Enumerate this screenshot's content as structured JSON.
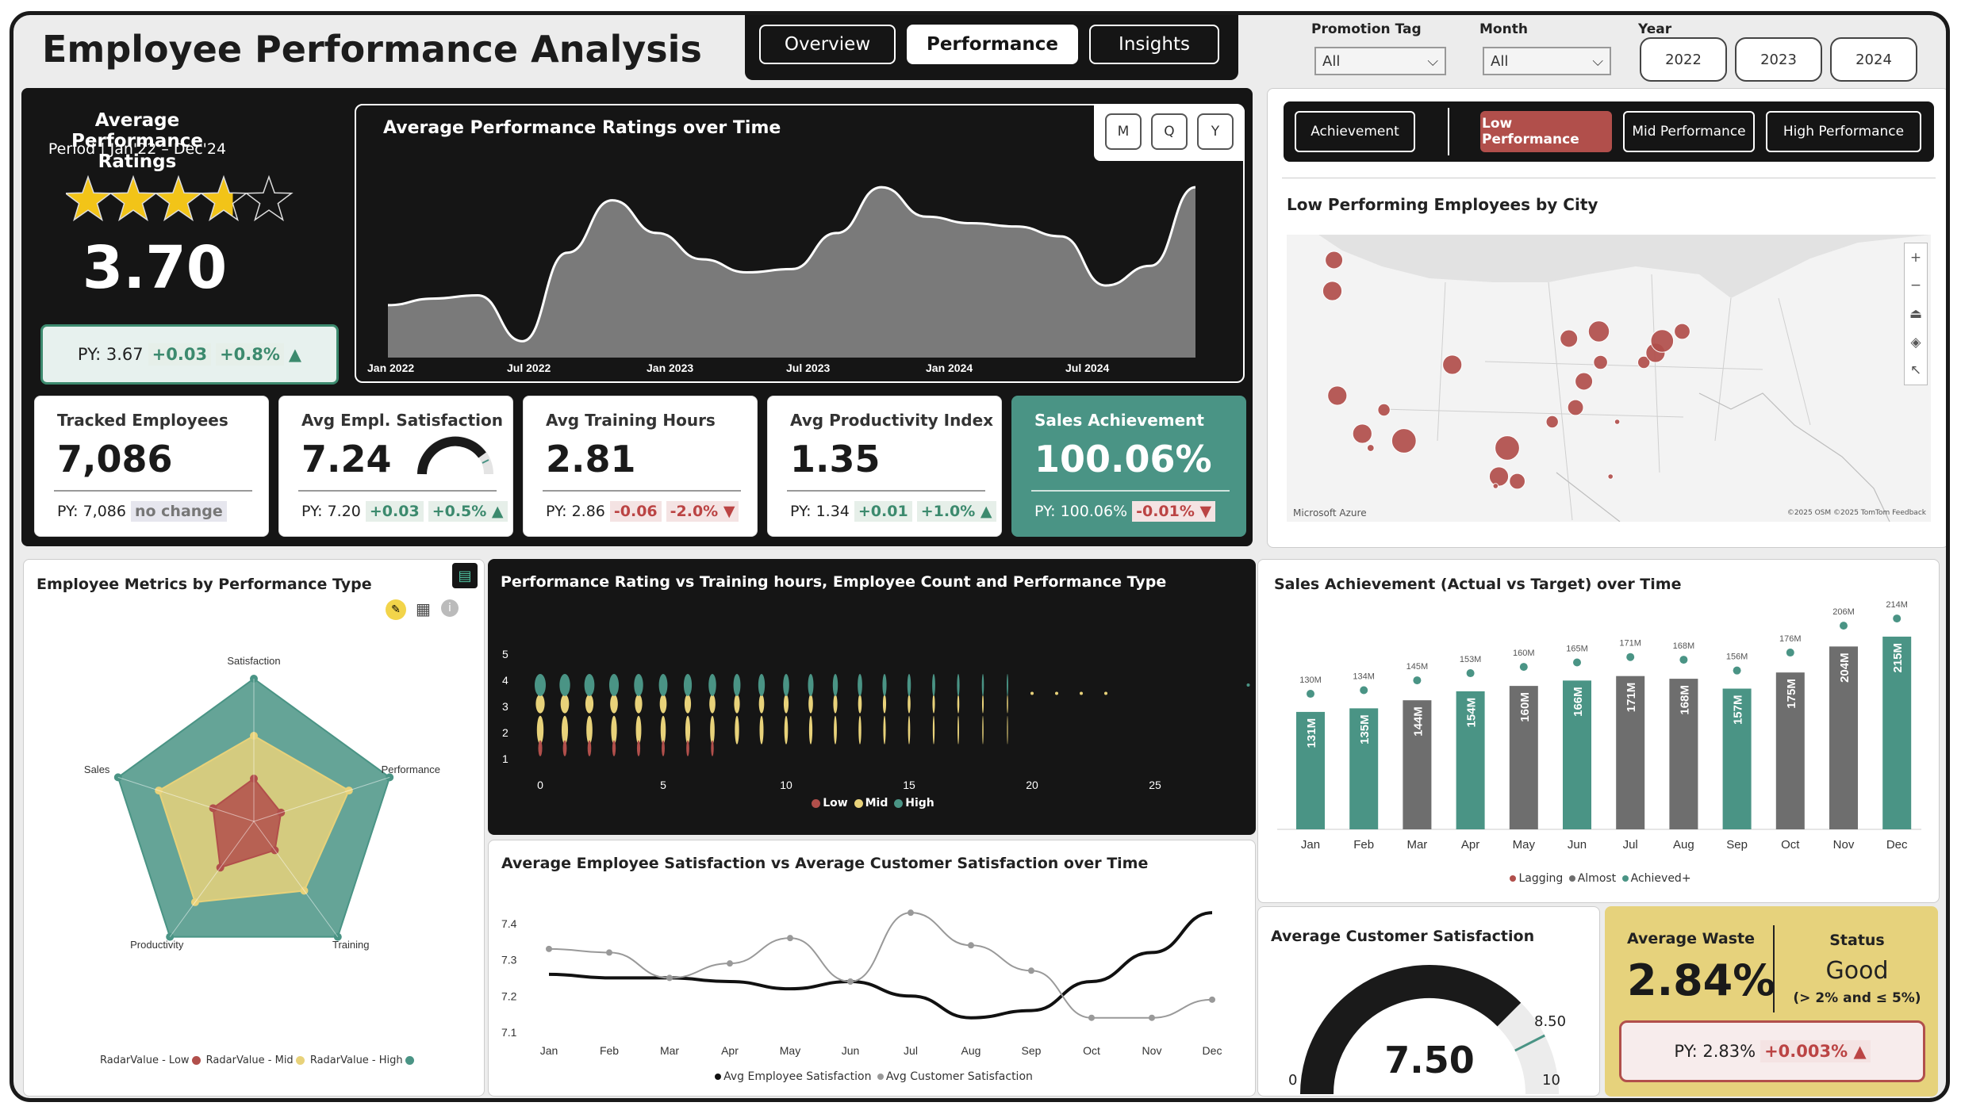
{
  "header": {
    "title": "Employee Performance Analysis"
  },
  "nav": {
    "tabs": [
      {
        "label": "Overview"
      },
      {
        "label": "Performance"
      },
      {
        "label": "Insights"
      }
    ]
  },
  "filters": {
    "promotion_tag": {
      "label": "Promotion Tag",
      "value": "All"
    },
    "month": {
      "label": "Month",
      "value": "All"
    },
    "year": {
      "label": "Year",
      "options": [
        "2022",
        "2023",
        "2024"
      ]
    }
  },
  "rating_card": {
    "title": "Average Performance Ratings",
    "period": "Period | Jan'22 – Dec'24",
    "stars_value": 3.7,
    "stars_max": 5,
    "value": "3.70",
    "py": "PY: 3.67",
    "delta": "+0.03",
    "delta_pct": "+0.8%",
    "arrow": "▲"
  },
  "ratings_over_time": {
    "title": "Average Performance Ratings over Time",
    "granularity": [
      "M",
      "Q",
      "Y"
    ],
    "x_labels": [
      "Jan 2022",
      "Jul 2022",
      "Jan 2023",
      "Jul 2023",
      "Jan 2024",
      "Jul 2024"
    ]
  },
  "kpis": [
    {
      "title": "Tracked Employees",
      "value": "7,086",
      "py": "PY: 7,086",
      "delta": "no change",
      "delta_pct": ""
    },
    {
      "title": "Avg Empl. Satisfaction",
      "value": "7.24",
      "py": "PY: 7.20",
      "delta": "+0.03",
      "delta_pct": "+0.5% ▲"
    },
    {
      "title": "Avg Training Hours",
      "value": "2.81",
      "py": "PY: 2.86",
      "delta": "-0.06",
      "delta_pct": "-2.0% ▼"
    },
    {
      "title": "Avg Productivity Index",
      "value": "1.35",
      "py": "PY: 1.34",
      "delta": "+0.01",
      "delta_pct": "+1.0% ▲"
    },
    {
      "title": "Sales Achievement",
      "value": "100.06%",
      "py": "PY: 100.06%",
      "delta": "-0.01% ▼",
      "delta_pct": ""
    }
  ],
  "perf_filter": {
    "buttons": [
      "Achievement",
      "Low Performance",
      "Mid Performance",
      "High Performance"
    ],
    "active": "Low Performance"
  },
  "map": {
    "title": "Low Performing Employees by City",
    "attribution_left": "Microsoft Azure",
    "attribution_right": "©2025 OSM ©2025 TomTom Feedback"
  },
  "radar": {
    "title": "Employee Metrics by Performance Type",
    "axes": [
      "Satisfaction",
      "Performance",
      "Training",
      "Productivity",
      "Sales"
    ],
    "legend": [
      "RadarValue - Low",
      "RadarValue - Mid",
      "RadarValue - High"
    ]
  },
  "violin": {
    "title": "Performance Rating vs Training hours, Employee Count and Performance Type",
    "x_ticks": [
      "0",
      "5",
      "10",
      "15",
      "20",
      "25"
    ],
    "y_ticks": [
      "1",
      "2",
      "3",
      "4",
      "5"
    ],
    "legend": [
      "Low",
      "Mid",
      "High"
    ]
  },
  "satisfaction": {
    "title": "Average Employee Satisfaction vs Average Customer Satisfaction over Time",
    "legend": [
      "Avg Employee Satisfaction",
      "Avg Customer Satisfaction"
    ]
  },
  "sales": {
    "title": "Sales Achievement (Actual vs Target) over Time",
    "legend": [
      "Lagging",
      "Almost",
      "Achieved+"
    ]
  },
  "customer_gauge": {
    "title": "Average Customer Satisfaction",
    "value": "7.50",
    "min": "0",
    "max": "10",
    "target": "8.50",
    "value_num": 7.5,
    "target_num": 8.5
  },
  "waste": {
    "title": "Average Waste",
    "value": "2.84%",
    "status_title": "Status",
    "status": "Good",
    "status_rule": "(> 2% and ≤ 5%)",
    "py": "PY: 2.83%",
    "delta": "+0.003% ▲"
  },
  "colors": {
    "teal": "#4a9485",
    "gray": "#6e6e6e",
    "red": "#b14f4b",
    "yellow": "#e8d27a",
    "dark": "#151515"
  },
  "chart_data": [
    {
      "type": "area",
      "title": "Average Performance Ratings over Time",
      "x": [
        "Jan 2022",
        "Mar 2022",
        "May 2022",
        "Jul 2022",
        "Sep 2022",
        "Nov 2022",
        "Jan 2023",
        "Mar 2023",
        "May 2023",
        "Jul 2023",
        "Sep 2023",
        "Nov 2023",
        "Jan 2024",
        "Mar 2024",
        "May 2024",
        "Jul 2024",
        "Sep 2024",
        "Nov 2024",
        "Dec 2024"
      ],
      "values": [
        3.56,
        3.58,
        3.59,
        3.45,
        3.72,
        3.88,
        3.78,
        3.7,
        3.66,
        3.67,
        3.78,
        3.92,
        3.83,
        3.81,
        3.8,
        3.77,
        3.62,
        3.68,
        3.92
      ],
      "ylim": [
        3.4,
        4.0
      ]
    },
    {
      "type": "line",
      "title": "Average Employee Satisfaction vs Average Customer Satisfaction over Time",
      "categories": [
        "Jan",
        "Feb",
        "Mar",
        "Apr",
        "May",
        "Jun",
        "Jul",
        "Aug",
        "Sep",
        "Oct",
        "Nov",
        "Dec"
      ],
      "series": [
        {
          "name": "Avg Employee Satisfaction",
          "values": [
            7.26,
            7.25,
            7.25,
            7.24,
            7.22,
            7.24,
            7.2,
            7.14,
            7.16,
            7.24,
            7.32,
            7.43
          ]
        },
        {
          "name": "Avg Customer Satisfaction",
          "values": [
            7.33,
            7.32,
            7.25,
            7.29,
            7.36,
            7.24,
            7.43,
            7.34,
            7.27,
            7.14,
            7.14,
            7.19
          ]
        }
      ],
      "y_ticks": [
        "7.1",
        "7.2",
        "7.3",
        "7.4"
      ],
      "ylim": [
        7.1,
        7.45
      ]
    },
    {
      "type": "bar",
      "title": "Sales Achievement (Actual vs Target) over Time",
      "categories": [
        "Jan",
        "Feb",
        "Mar",
        "Apr",
        "May",
        "Jun",
        "Jul",
        "Aug",
        "Sep",
        "Oct",
        "Nov",
        "Dec"
      ],
      "actual": [
        131,
        135,
        144,
        154,
        160,
        166,
        171,
        168,
        157,
        175,
        204,
        215
      ],
      "actual_labels": [
        "131M",
        "135M",
        "144M",
        "154M",
        "160M",
        "166M",
        "171M",
        "168M",
        "157M",
        "175M",
        "204M",
        "215M"
      ],
      "target": [
        130,
        134,
        145,
        153,
        160,
        165,
        171,
        168,
        156,
        176,
        206,
        214
      ],
      "target_labels": [
        "130M",
        "134M",
        "145M",
        "153M",
        "160M",
        "165M",
        "171M",
        "168M",
        "156M",
        "176M",
        "206M",
        "214M"
      ],
      "status": [
        "Achieved+",
        "Achieved+",
        "Almost",
        "Achieved+",
        "Almost",
        "Achieved+",
        "Almost",
        "Almost",
        "Achieved+",
        "Almost",
        "Almost",
        "Achieved+"
      ],
      "ylim": [
        0,
        230
      ]
    },
    {
      "type": "radar",
      "title": "Employee Metrics by Performance Type",
      "axes": [
        "Satisfaction",
        "Performance",
        "Training",
        "Productivity",
        "Sales"
      ],
      "series": [
        {
          "name": "RadarValue - Low",
          "values": [
            0.3,
            0.2,
            0.25,
            0.4,
            0.3
          ]
        },
        {
          "name": "RadarValue - Mid",
          "values": [
            0.6,
            0.7,
            0.6,
            0.7,
            0.7
          ]
        },
        {
          "name": "RadarValue - High",
          "values": [
            1,
            1,
            1,
            1,
            1
          ]
        }
      ]
    }
  ]
}
